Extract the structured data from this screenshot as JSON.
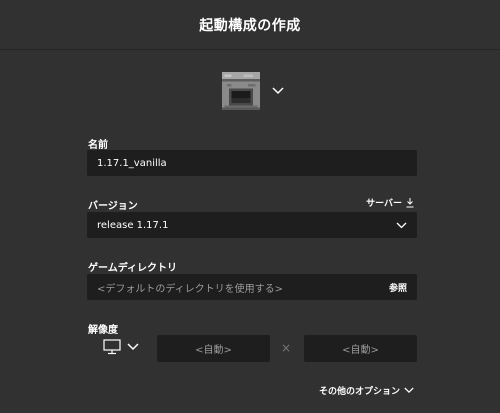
{
  "dialog": {
    "title": "起動構成の作成"
  },
  "name": {
    "label": "名前",
    "value": "1.17.1_vanilla"
  },
  "version": {
    "label": "バージョン",
    "server_link": "サーバー",
    "value": "release 1.17.1"
  },
  "game_dir": {
    "label": "ゲームディレクトリ",
    "placeholder": "<デフォルトのディレクトリを使用する>",
    "browse_label": "参照"
  },
  "resolution": {
    "label": "解像度",
    "width_placeholder": "<自動>",
    "height_placeholder": "<自動>",
    "separator": "×"
  },
  "more_options_label": "その他のオプション",
  "icons": {
    "profile_icon": "furnace-icon",
    "display_icon": "monitor-icon"
  },
  "colors": {
    "background": "#313131",
    "field_background": "#1e1e1e",
    "placeholder_text": "#9a9a9a"
  }
}
